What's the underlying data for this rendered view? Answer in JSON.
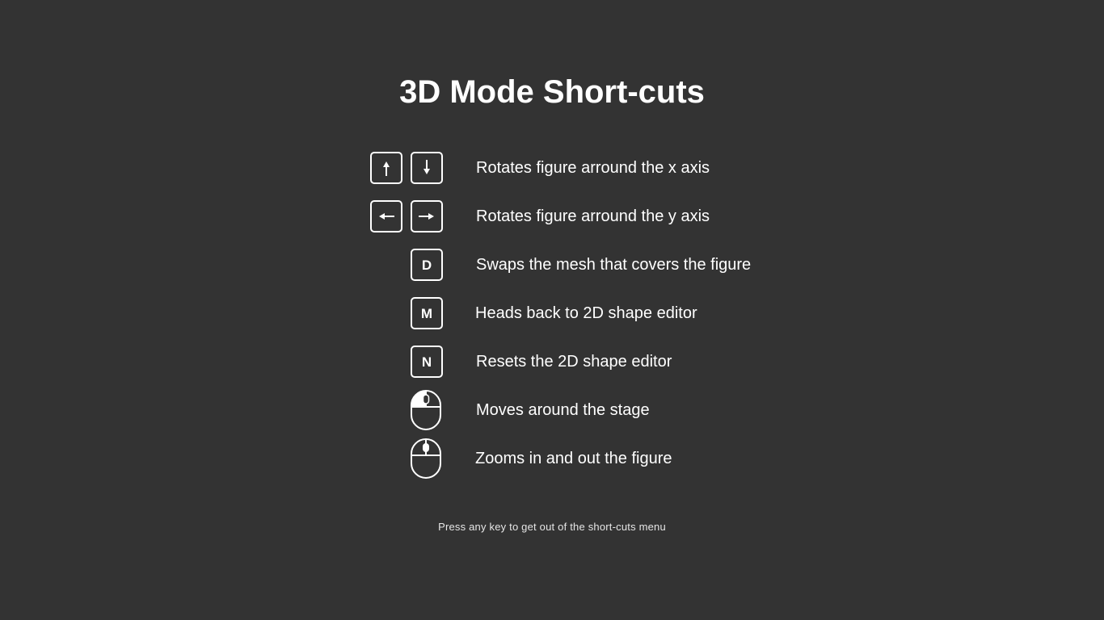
{
  "title": "3D Mode Short-cuts",
  "shortcuts": [
    {
      "keys": [
        "arrow-up",
        "arrow-down"
      ],
      "description": "Rotates figure arround the x axis"
    },
    {
      "keys": [
        "arrow-left",
        "arrow-right"
      ],
      "description": "Rotates figure arround the y axis"
    },
    {
      "keys": [
        "D"
      ],
      "description": "Swaps the mesh that covers the figure"
    },
    {
      "keys": [
        "M"
      ],
      "description": "Heads back to 2D shape editor"
    },
    {
      "keys": [
        "N"
      ],
      "description": "Resets the 2D shape editor"
    },
    {
      "keys": [
        "mouse-left-button"
      ],
      "description": "Moves around the stage"
    },
    {
      "keys": [
        "mouse-scroll-wheel"
      ],
      "description": "Zooms in and out the figure"
    }
  ],
  "footer": "Press any key to get out of the short-cuts menu",
  "colors": {
    "background": "#333333",
    "foreground": "#ffffff"
  }
}
